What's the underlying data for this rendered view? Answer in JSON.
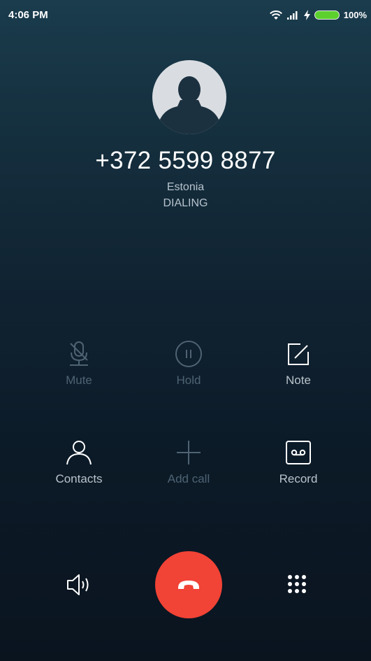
{
  "status_bar": {
    "time": "4:06 PM",
    "battery_percent": "100%",
    "battery_color": "#5cd12e",
    "icons": [
      "wifi-icon",
      "signal-icon",
      "charging-icon",
      "battery-icon"
    ]
  },
  "caller": {
    "number": "+372 5599 8877",
    "location": "Estonia",
    "state": "DIALING",
    "avatar_icon": "person-silhouette-icon"
  },
  "actions": {
    "mute": {
      "label": "Mute",
      "enabled": false,
      "icon": "mic-off-icon"
    },
    "hold": {
      "label": "Hold",
      "enabled": false,
      "icon": "pause-icon"
    },
    "note": {
      "label": "Note",
      "enabled": true,
      "icon": "note-icon"
    },
    "contacts": {
      "label": "Contacts",
      "enabled": true,
      "icon": "person-icon"
    },
    "add_call": {
      "label": "Add call",
      "enabled": false,
      "icon": "plus-icon"
    },
    "record": {
      "label": "Record",
      "enabled": true,
      "icon": "tape-icon"
    }
  },
  "controls": {
    "speaker_icon": "speaker-icon",
    "end_call_icon": "end-call-icon",
    "end_call_color": "#f14336",
    "dialpad_icon": "dialpad-icon"
  }
}
